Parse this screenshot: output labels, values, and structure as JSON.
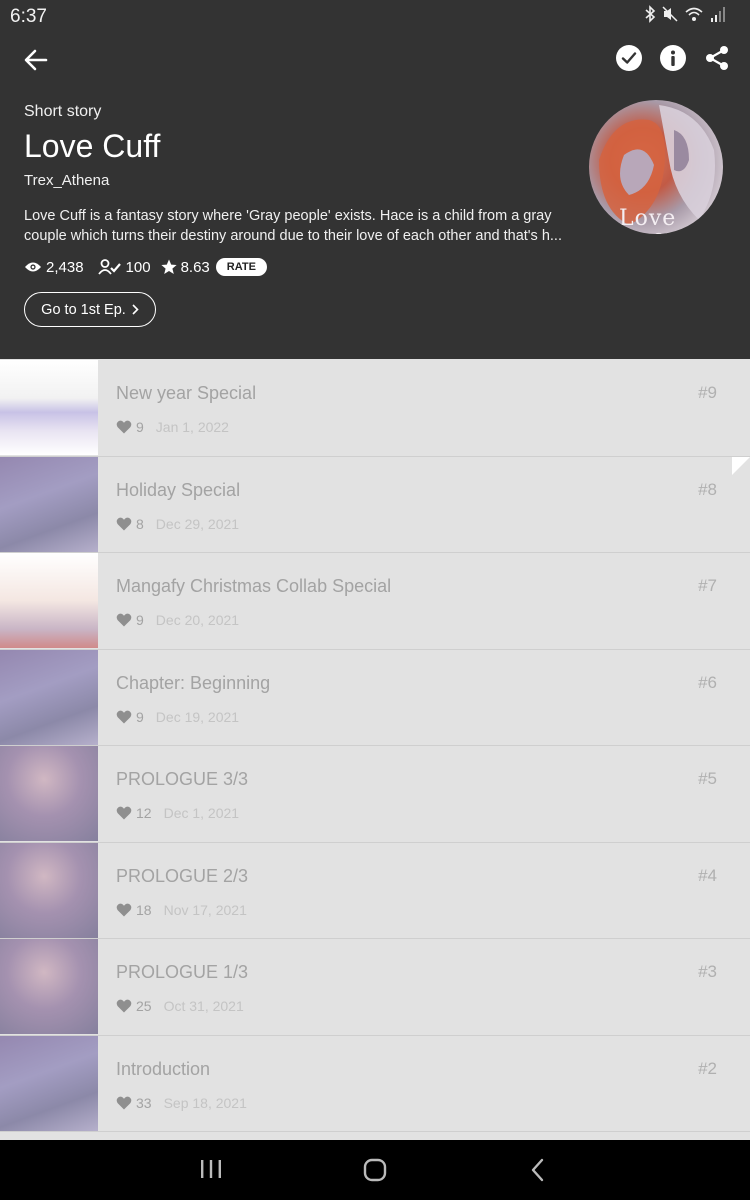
{
  "status_bar": {
    "time": "6:37"
  },
  "header": {
    "story_type": "Short story",
    "title": "Love Cuff",
    "author": "Trex_Athena",
    "description_line1": "Love Cuff is a fantasy story where 'Gray people' exists. Hace is a child from a gray",
    "description_line2": "couple which turns their destiny around due to their love of each other and that's h...",
    "views": "2,438",
    "subscribers": "100",
    "rating": "8.63",
    "rate_label": "RATE",
    "first_ep_label": "Go to 1st Ep.",
    "cover_text": "Love Cuff"
  },
  "episodes": [
    {
      "title": "New year Special",
      "likes": "9",
      "date": "Jan 1, 2022",
      "number": "#9"
    },
    {
      "title": "Holiday Special",
      "likes": "8",
      "date": "Dec 29, 2021",
      "number": "#8"
    },
    {
      "title": "Mangafy Christmas Collab Special",
      "likes": "9",
      "date": "Dec 20, 2021",
      "number": "#7"
    },
    {
      "title": "Chapter: Beginning",
      "likes": "9",
      "date": "Dec 19, 2021",
      "number": "#6"
    },
    {
      "title": "PROLOGUE 3/3",
      "likes": "12",
      "date": "Dec 1, 2021",
      "number": "#5"
    },
    {
      "title": "PROLOGUE 2/3",
      "likes": "18",
      "date": "Nov 17, 2021",
      "number": "#4"
    },
    {
      "title": "PROLOGUE 1/3",
      "likes": "25",
      "date": "Oct 31, 2021",
      "number": "#3"
    },
    {
      "title": "Introduction",
      "likes": "33",
      "date": "Sep 18, 2021",
      "number": "#2"
    }
  ],
  "icons": {
    "back": "arrow-left-icon",
    "check": "check-circle-icon",
    "info": "info-icon",
    "share": "share-icon",
    "views": "eye-icon",
    "subscribers": "user-check-icon",
    "rating": "star-icon",
    "likes": "heart-icon"
  },
  "colors": {
    "header_bg": "#333333",
    "list_bg": "#e2e2e2",
    "navbar_bg": "#000000"
  }
}
